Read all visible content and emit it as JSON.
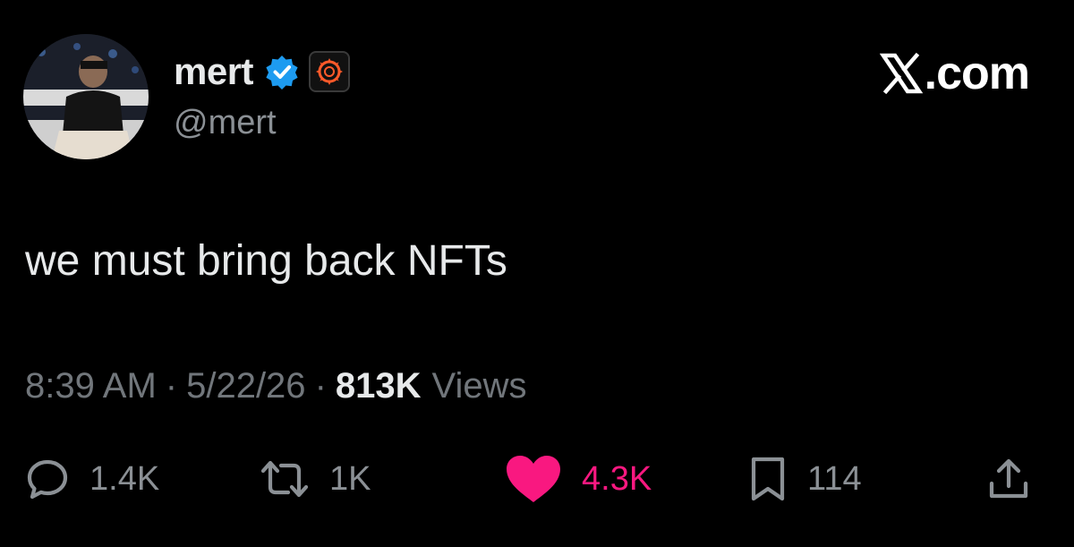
{
  "tweet": {
    "author": {
      "display_name": "mert",
      "handle": "@mert",
      "verified": true,
      "avatar_icon": "profile-photo",
      "affiliate_icon": "affiliate-badge-icon"
    },
    "brand": {
      "label": ".com",
      "icon": "x-logo-icon"
    },
    "text": "we must bring back NFTs",
    "meta": {
      "time": "8:39 AM",
      "separator": "·",
      "date": "5/22/26",
      "views_count": "813K",
      "views_label": "Views"
    },
    "actions": {
      "replies": "1.4K",
      "reposts": "1K",
      "likes": "4.3K",
      "bookmarks": "114"
    },
    "colors": {
      "background": "#000000",
      "text": "#e7e9ea",
      "secondary": "#71767b",
      "verified_blue": "#1d9bf0",
      "like_pink": "#f91880",
      "affiliate_orange": "#ff5a2a"
    }
  }
}
